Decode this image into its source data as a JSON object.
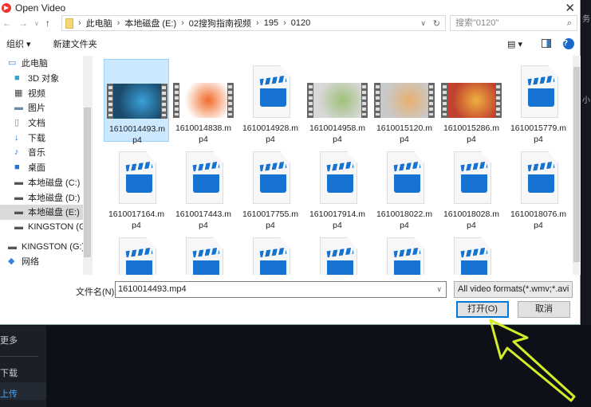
{
  "title": "Open Video",
  "breadcrumb": [
    "此电脑",
    "本地磁盘 (E:)",
    "02搜狗指南视频",
    "195",
    "0120"
  ],
  "search_placeholder": "搜索\"0120\"",
  "toolbar": {
    "organize": "组织 ▾",
    "new_folder": "新建文件夹"
  },
  "nav_pane": [
    {
      "label": "此电脑",
      "icon": "computer-icon"
    },
    {
      "label": "3D 对象",
      "icon": "cube-icon"
    },
    {
      "label": "视频",
      "icon": "video-icon"
    },
    {
      "label": "图片",
      "icon": "picture-icon"
    },
    {
      "label": "文档",
      "icon": "document-icon"
    },
    {
      "label": "下载",
      "icon": "download-icon"
    },
    {
      "label": "音乐",
      "icon": "music-icon"
    },
    {
      "label": "桌面",
      "icon": "desktop-icon"
    },
    {
      "label": "本地磁盘 (C:)",
      "icon": "drive-icon"
    },
    {
      "label": "本地磁盘 (D:)",
      "icon": "drive-icon"
    },
    {
      "label": "本地磁盘 (E:)",
      "icon": "drive-icon",
      "selected": true
    },
    {
      "label": "KINGSTON (G:)",
      "icon": "drive-icon"
    },
    {
      "label": "KINGSTON (G:)",
      "icon": "usb-drive-icon"
    },
    {
      "label": "网络",
      "icon": "network-icon"
    }
  ],
  "files": [
    {
      "name": "1610014493.mp4",
      "thumb": "video",
      "selected": true,
      "colors": [
        "#1b4a6b",
        "#3aa0d8"
      ]
    },
    {
      "name": "1610014838.mp4",
      "thumb": "video",
      "colors": [
        "#ffffff",
        "#f06b2a"
      ]
    },
    {
      "name": "1610014928.mp4",
      "thumb": "doc"
    },
    {
      "name": "1610014958.mp4",
      "thumb": "video",
      "colors": [
        "#d8d8d8",
        "#9fc07a"
      ]
    },
    {
      "name": "1610015120.mp4",
      "thumb": "video",
      "colors": [
        "#c9c9c9",
        "#e8b070"
      ]
    },
    {
      "name": "1610015286.mp4",
      "thumb": "video",
      "colors": [
        "#c0412e",
        "#f0b040"
      ]
    },
    {
      "name": "1610015779.mp4",
      "thumb": "doc"
    },
    {
      "name": "1610017164.mp4",
      "thumb": "doc"
    },
    {
      "name": "1610017443.mp4",
      "thumb": "doc"
    },
    {
      "name": "1610017755.mp4",
      "thumb": "doc"
    },
    {
      "name": "1610017914.mp4",
      "thumb": "doc"
    },
    {
      "name": "1610018022.mp4",
      "thumb": "doc"
    },
    {
      "name": "1610018028.mp4",
      "thumb": "doc"
    },
    {
      "name": "1610018076.mp4",
      "thumb": "doc"
    },
    {
      "name": "",
      "thumb": "doc"
    },
    {
      "name": "",
      "thumb": "doc"
    },
    {
      "name": "",
      "thumb": "doc"
    },
    {
      "name": "",
      "thumb": "doc"
    },
    {
      "name": "",
      "thumb": "doc"
    },
    {
      "name": "",
      "thumb": "doc"
    }
  ],
  "filename_label": "文件名(N):",
  "filename_value": "1610014493.mp4",
  "filter": "All video formats(*.wmv;*.avi",
  "open_button": "打开(O)",
  "cancel_button": "取消",
  "background_app": {
    "items": [
      "更多",
      "下载",
      "上传"
    ],
    "active": "上传",
    "active_color": "#3ea6ff",
    "edge_text": [
      "务",
      "小"
    ]
  },
  "annotation_arrow_color": "#d4ec2a"
}
